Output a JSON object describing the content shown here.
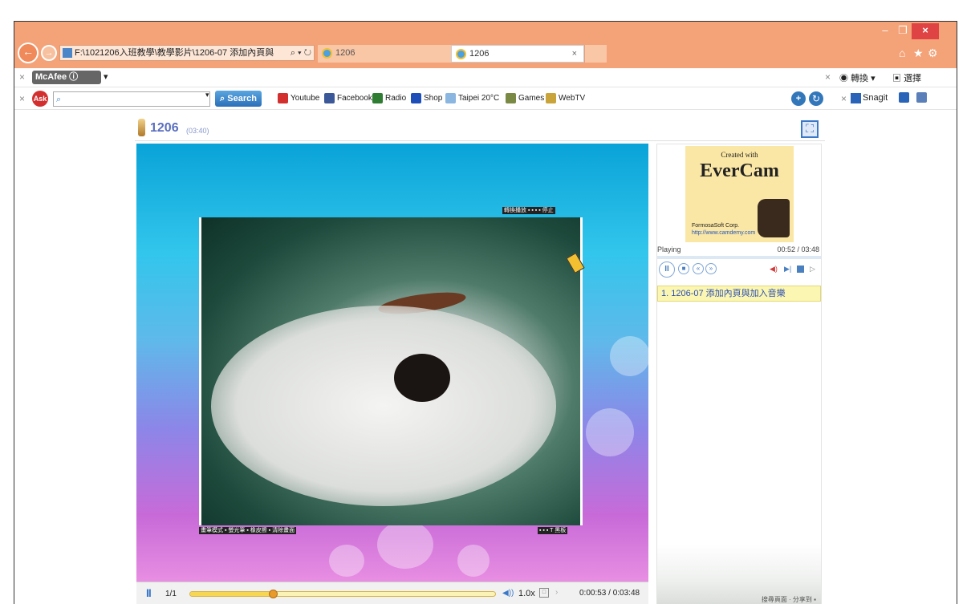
{
  "window": {
    "min": "–",
    "max": "❐",
    "close": "×"
  },
  "browser": {
    "address": "F:\\1021206入班教學\\教學影片\\1206-07 添加內頁與",
    "address_ctrls": "⌕ ▾ ↻",
    "tabs": [
      {
        "label": "1206"
      },
      {
        "label": "1206"
      }
    ],
    "tab_close": "×"
  },
  "toolbar1": {
    "close": "×",
    "mcafee": "McAfee",
    "close_right": "×",
    "translate": "轉換",
    "select": "選擇"
  },
  "toolbar2": {
    "close": "×",
    "ask": "Ask",
    "search_btn": "Search",
    "links": [
      {
        "label": "Youtube",
        "color": "#d32f2f"
      },
      {
        "label": "Facebook",
        "color": "#3b5998"
      },
      {
        "label": "Radio",
        "color": "#2e7d32"
      },
      {
        "label": "Shop",
        "color": "#1e4fb8"
      },
      {
        "label": "Taipei 20°C",
        "color": "#8ab6e0"
      },
      {
        "label": "Games",
        "color": "#7a8a44"
      },
      {
        "label": "WebTV",
        "color": "#c9a43a"
      }
    ],
    "close_right": "×",
    "snagit": "Snagit"
  },
  "player": {
    "title": "1206",
    "duration": "(03:40)",
    "video_labels": {
      "top_ctrl": "轉換播放 ▪ ▪ ▪ ▪ 停止",
      "bottom_left": "畫筆模式 ▪ 螢光筆 ▪ 橡皮擦 ▪ 清除畫面",
      "bottom_right": "▪ ▪ ▪ T 黑板"
    },
    "page_count": "1/1",
    "progress": 0.27,
    "speed": "1.0x",
    "time": "0:00:53 / 0:03:48"
  },
  "sidebar": {
    "thumb": {
      "created": "Created with",
      "brand": "EverCam",
      "company": "FormosaSoft Corp.",
      "url": "http://www.camdemy.com"
    },
    "status": "Playing",
    "status_time": "00:52 / 03:48",
    "playlist": [
      "1. 1206-07 添加內頁與加入音樂"
    ],
    "footer": "搜尋頁面 · 分享到 ▪"
  }
}
